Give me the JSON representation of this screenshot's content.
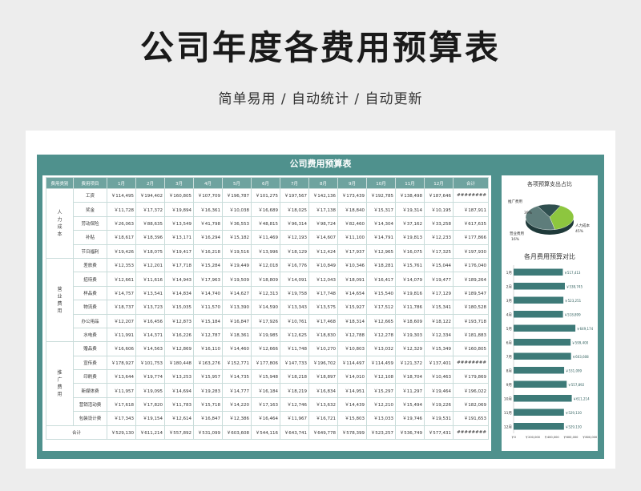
{
  "page": {
    "title": "公司年度各费用预算表",
    "subtitle": "简单易用 / 自动统计 / 自动更新"
  },
  "sheet": {
    "title": "公司费用预算表",
    "headers": [
      "费用类别",
      "费用项目",
      "1月",
      "2月",
      "3月",
      "4月",
      "5月",
      "6月",
      "7月",
      "8月",
      "9月",
      "10月",
      "11月",
      "12月",
      "合计"
    ],
    "groups": [
      {
        "category": "人力成本",
        "rows": [
          {
            "item": "工资",
            "values": [
              "￥114,495",
              "￥194,402",
              "￥160,805",
              "￥107,709",
              "￥196,787",
              "￥101,275",
              "￥197,567",
              "￥142,136",
              "￥173,439",
              "￥192,785",
              "￥138,498",
              "￥187,646",
              "########"
            ]
          },
          {
            "item": "奖金",
            "values": [
              "￥11,728",
              "￥17,372",
              "￥19,894",
              "￥16,361",
              "￥10,038",
              "￥16,689",
              "￥18,025",
              "￥17,138",
              "￥18,840",
              "￥15,317",
              "￥19,314",
              "￥10,195",
              "￥187,911"
            ]
          },
          {
            "item": "劳动保险",
            "values": [
              "￥26,063",
              "￥88,635",
              "￥13,549",
              "￥41,798",
              "￥36,553",
              "￥48,815",
              "￥96,314",
              "￥98,724",
              "￥82,460",
              "￥14,304",
              "￥37,162",
              "￥33,258",
              "￥617,635"
            ]
          },
          {
            "item": "补贴",
            "values": [
              "￥18,617",
              "￥18,396",
              "￥13,171",
              "￥16,294",
              "￥15,182",
              "￥11,469",
              "￥12,193",
              "￥14,607",
              "￥11,100",
              "￥14,791",
              "￥19,813",
              "￥12,233",
              "￥177,866"
            ]
          },
          {
            "item": "节日福利",
            "values": [
              "￥19,426",
              "￥18,075",
              "￥19,417",
              "￥16,218",
              "￥19,516",
              "￥13,996",
              "￥18,129",
              "￥12,424",
              "￥17,937",
              "￥12,965",
              "￥16,075",
              "￥17,325",
              "￥197,930"
            ]
          }
        ]
      },
      {
        "category": "营业费用",
        "rows": [
          {
            "item": "差旅费",
            "values": [
              "￥12,353",
              "￥12,201",
              "￥17,718",
              "￥15,284",
              "￥19,449",
              "￥12,018",
              "￥16,776",
              "￥10,849",
              "￥10,346",
              "￥18,281",
              "￥15,761",
              "￥15,044",
              "￥176,040"
            ]
          },
          {
            "item": "招待费",
            "values": [
              "￥12,661",
              "￥11,616",
              "￥14,943",
              "￥17,963",
              "￥19,509",
              "￥18,809",
              "￥14,091",
              "￥12,043",
              "￥18,091",
              "￥16,417",
              "￥14,079",
              "￥19,477",
              "￥189,264"
            ]
          },
          {
            "item": "样品费",
            "values": [
              "￥14,757",
              "￥13,541",
              "￥14,834",
              "￥14,740",
              "￥14,627",
              "￥12,313",
              "￥19,758",
              "￥17,748",
              "￥14,654",
              "￥15,540",
              "￥19,816",
              "￥17,129",
              "￥189,547"
            ]
          },
          {
            "item": "物流费",
            "values": [
              "￥18,737",
              "￥13,723",
              "￥15,035",
              "￥11,570",
              "￥13,390",
              "￥14,590",
              "￥13,343",
              "￥13,575",
              "￥15,927",
              "￥17,512",
              "￥11,786",
              "￥15,341",
              "￥180,528"
            ]
          },
          {
            "item": "办公用品",
            "values": [
              "￥12,207",
              "￥16,456",
              "￥12,873",
              "￥15,184",
              "￥16,847",
              "￥17,926",
              "￥10,761",
              "￥17,468",
              "￥18,314",
              "￥12,665",
              "￥18,609",
              "￥18,122",
              "￥193,718"
            ]
          },
          {
            "item": "水电费",
            "values": [
              "￥11,991",
              "￥14,371",
              "￥16,226",
              "￥12,787",
              "￥18,361",
              "￥19,985",
              "￥12,625",
              "￥18,830",
              "￥12,788",
              "￥12,278",
              "￥19,303",
              "￥12,334",
              "￥181,883"
            ]
          }
        ]
      },
      {
        "category": "推广费用",
        "rows": [
          {
            "item": "赠品费",
            "values": [
              "￥16,606",
              "￥14,563",
              "￥12,869",
              "￥16,110",
              "￥14,460",
              "￥12,666",
              "￥11,748",
              "￥10,270",
              "￥10,803",
              "￥13,032",
              "￥12,329",
              "￥15,349",
              "￥160,805"
            ]
          },
          {
            "item": "宣传费",
            "values": [
              "￥178,927",
              "￥101,753",
              "￥180,448",
              "￥163,276",
              "￥152,771",
              "￥177,806",
              "￥147,733",
              "￥196,702",
              "￥114,497",
              "￥114,459",
              "￥121,372",
              "￥137,401",
              "########"
            ]
          },
          {
            "item": "印刷费",
            "values": [
              "￥13,644",
              "￥19,774",
              "￥13,253",
              "￥15,957",
              "￥14,735",
              "￥15,948",
              "￥18,218",
              "￥18,897",
              "￥14,010",
              "￥12,108",
              "￥18,704",
              "￥10,463",
              "￥179,869"
            ]
          },
          {
            "item": "新媒体费",
            "values": [
              "￥11,957",
              "￥19,095",
              "￥14,694",
              "￥19,283",
              "￥14,777",
              "￥16,184",
              "￥18,219",
              "￥16,834",
              "￥14,951",
              "￥15,297",
              "￥11,297",
              "￥19,464",
              "￥196,022"
            ]
          },
          {
            "item": "营销活动费",
            "values": [
              "￥17,618",
              "￥17,820",
              "￥11,783",
              "￥15,718",
              "￥14,220",
              "￥17,163",
              "￥12,746",
              "￥13,632",
              "￥14,439",
              "￥12,210",
              "￥15,494",
              "￥19,226",
              "￥182,069"
            ]
          },
          {
            "item": "包装设计费",
            "values": [
              "￥17,343",
              "￥19,154",
              "￥12,614",
              "￥16,847",
              "￥12,386",
              "￥16,464",
              "￥11,967",
              "￥16,721",
              "￥15,803",
              "￥13,033",
              "￥19,746",
              "￥19,531",
              "￥191,653"
            ]
          }
        ]
      }
    ],
    "total": {
      "label": "合计",
      "values": [
        "￥529,130",
        "￥611,214",
        "￥557,892",
        "￥531,099",
        "￥603,608",
        "￥544,116",
        "￥643,741",
        "￥649,778",
        "￥578,399",
        "￥523,257",
        "￥536,749",
        "￥577,431",
        "########"
      ]
    }
  },
  "chart_data": [
    {
      "type": "pie",
      "title": "各项预算支出占比",
      "labels": [
        "推广费用",
        "人力成本",
        "营业费用"
      ],
      "values": [
        39,
        45,
        16
      ],
      "percent_labels": [
        "39%",
        "45%",
        "16%"
      ],
      "colors": [
        "#8dc63f",
        "#5e7d7b",
        "#2f4f4f"
      ]
    },
    {
      "type": "bar",
      "orientation": "horizontal",
      "title": "各月费用预算对比",
      "categories": [
        "1月",
        "2月",
        "3月",
        "4月",
        "5月",
        "6月",
        "7月",
        "8月",
        "9月",
        "10月",
        "11月",
        "12月"
      ],
      "values": [
        517413,
        538745,
        523251,
        518899,
        649174,
        599400,
        603608,
        531099,
        557892,
        611214,
        529130,
        529130
      ],
      "value_labels": [
        "￥517,413",
        "￥538,745",
        "￥523,251",
        "￥518,899",
        "￥649,174",
        "￥599,400",
        "￥603,608",
        "￥531,099",
        "￥557,892",
        "￥611,214",
        "￥529,130",
        "￥529,130"
      ],
      "xlim": [
        0,
        800000
      ],
      "tick_labels": [
        "￥0",
        "￥200,000",
        "￥400,000",
        "￥600,000",
        "￥800,000"
      ],
      "color": "#3d7a78"
    }
  ]
}
